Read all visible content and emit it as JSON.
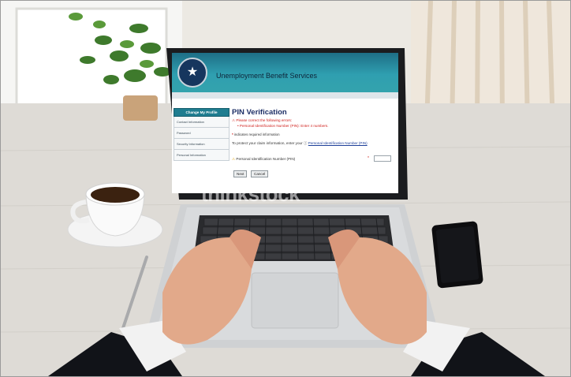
{
  "site": {
    "title": "Unemployment Benefit Services",
    "logo_icon": "state-seal-icon"
  },
  "sidenav": {
    "header": "Change My Profile",
    "items": [
      {
        "label": "Contact Information"
      },
      {
        "label": "Password"
      },
      {
        "label": "Security Information"
      },
      {
        "label": "Personal Information"
      }
    ]
  },
  "main": {
    "heading": "PIN Verification",
    "error_title": "Please correct the following errors:",
    "error_item": "Personal Identification Number (PIN): Enter 4 numbers.",
    "required_note": "indicates required information",
    "intro_text": "To protect your claim information, enter your",
    "intro_link": "Personal Identification Number (PIN)",
    "pin_label": "Personal Identification Number (PIN)",
    "pin_value": "",
    "next_label": "Next",
    "cancel_label": "Cancel"
  },
  "watermark": "thinkstock",
  "colors": {
    "header_teal": "#2f9fb0",
    "error_red": "#d0201c",
    "heading_navy": "#1d2f66"
  }
}
